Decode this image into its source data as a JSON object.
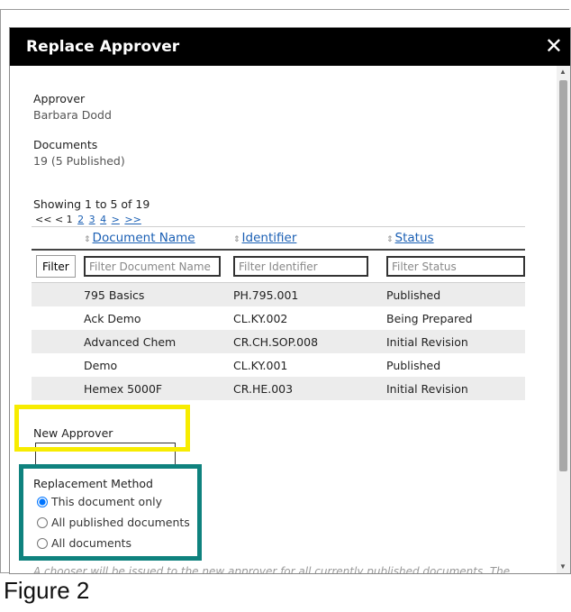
{
  "modal": {
    "title": "Replace Approver",
    "close_glyph": "✕"
  },
  "approver": {
    "label": "Approver",
    "value": "Barbara Dodd"
  },
  "documents": {
    "label": "Documents",
    "value": "19 (5 Published)"
  },
  "pagination": {
    "showing": "Showing 1 to 5 of 19",
    "first": "<<",
    "prev": "<",
    "current": "1",
    "pages": [
      "2",
      "3",
      "4"
    ],
    "next": ">",
    "last": ">>"
  },
  "table": {
    "sort_icon": "⇕",
    "columns": [
      "Document Name",
      "Identifier",
      "Status"
    ],
    "filter_button": "Filter",
    "filter_placeholders": [
      "Filter Document Name",
      "Filter Identifier",
      "Filter Status"
    ],
    "rows": [
      {
        "name": "795 Basics",
        "identifier": "PH.795.001",
        "status": "Published"
      },
      {
        "name": "Ack Demo",
        "identifier": "CL.KY.002",
        "status": "Being Prepared"
      },
      {
        "name": "Advanced Chem",
        "identifier": "CR.CH.SOP.008",
        "status": "Initial Revision"
      },
      {
        "name": "Demo",
        "identifier": "CL.KY.001",
        "status": "Published"
      },
      {
        "name": "Hemex 5000F",
        "identifier": "CR.HE.003",
        "status": "Initial Revision"
      }
    ]
  },
  "new_approver": {
    "label": "New Approver",
    "value": ""
  },
  "replacement": {
    "label": "Replacement Method",
    "options": [
      "This document only",
      "All published documents",
      "All documents"
    ],
    "selected": 0
  },
  "cutoff_text": "A chooser will be issued to the new approver for all currently published documents. The",
  "caption": "Figure 2",
  "colors": {
    "highlight_yellow": "#f7ec00",
    "highlight_teal": "#0f827e",
    "link": "#1a5fb4",
    "titlebar": "#000000"
  }
}
